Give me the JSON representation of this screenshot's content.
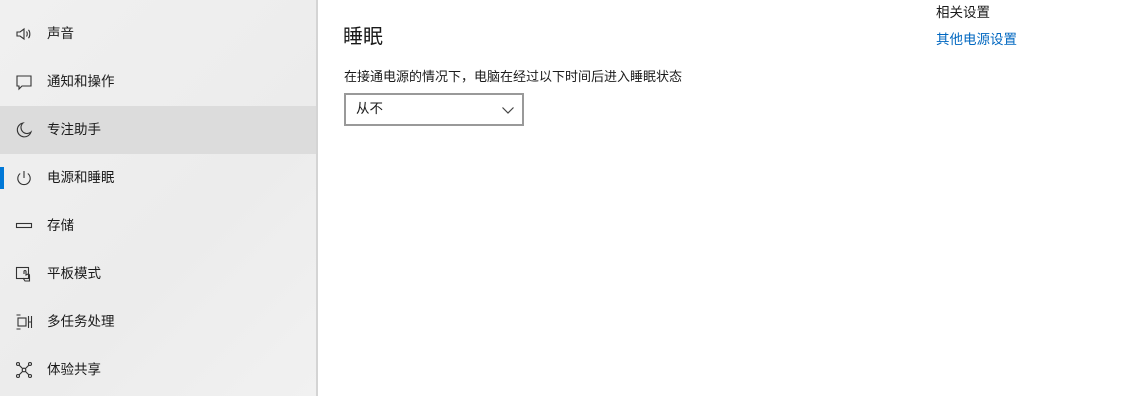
{
  "accent_color": "#0078d7",
  "sidebar": {
    "items": [
      {
        "label": "声音",
        "icon": "speaker-icon"
      },
      {
        "label": "通知和操作",
        "icon": "notification-icon"
      },
      {
        "label": "专注助手",
        "icon": "moon-icon"
      },
      {
        "label": "电源和睡眠",
        "icon": "power-icon"
      },
      {
        "label": "存储",
        "icon": "storage-icon"
      },
      {
        "label": "平板模式",
        "icon": "tablet-mode-icon"
      },
      {
        "label": "多任务处理",
        "icon": "multitasking-icon"
      },
      {
        "label": "体验共享",
        "icon": "shared-experiences-icon"
      }
    ],
    "selected": "电源和睡眠",
    "hovered": "专注助手"
  },
  "main": {
    "heading": "睡眠",
    "description": "在接通电源的情况下，电脑在经过以下时间后进入睡眠状态",
    "sleep_dropdown": {
      "value": "从不"
    }
  },
  "related": {
    "title": "相关设置",
    "link": "其他电源设置"
  }
}
